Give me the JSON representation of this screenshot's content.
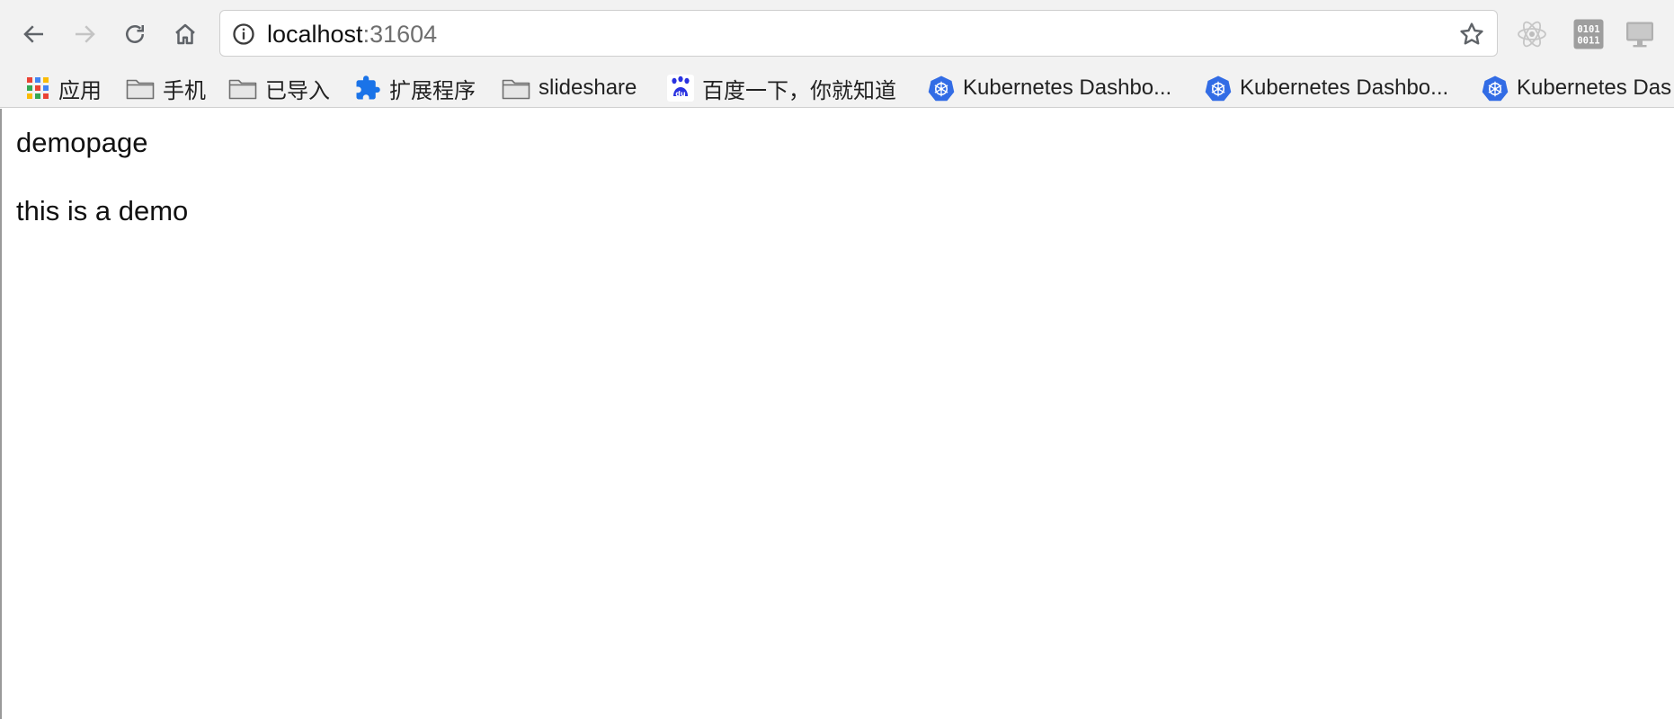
{
  "browser": {
    "url_host": "localhost",
    "url_port": ":31604"
  },
  "icons": {
    "back": "back-arrow-icon",
    "forward": "forward-arrow-icon",
    "reload": "reload-icon",
    "home": "home-icon",
    "site_info": "info-icon",
    "bookmark_star": "star-icon",
    "extensions": [
      "react-devtools-icon",
      "binary-extension-icon",
      "monitor-extension-icon"
    ]
  },
  "bookmarks": [
    {
      "label": "应用",
      "icon": "apps-grid-icon"
    },
    {
      "label": "手机",
      "icon": "folder-icon"
    },
    {
      "label": "已导入",
      "icon": "folder-icon"
    },
    {
      "label": "扩展程序",
      "icon": "puzzle-icon"
    },
    {
      "label": "slideshare",
      "icon": "folder-icon"
    },
    {
      "label": "百度一下，你就知道",
      "icon": "baidu-icon"
    },
    {
      "label": "Kubernetes Dashbo...",
      "icon": "kubernetes-icon"
    },
    {
      "label": "Kubernetes Dashbo...",
      "icon": "kubernetes-icon"
    },
    {
      "label": "Kubernetes Das",
      "icon": "kubernetes-icon"
    }
  ],
  "page": {
    "heading": "demopage",
    "paragraph": "this is a demo"
  },
  "colors": {
    "kubernetes_blue": "#326ce5",
    "puzzle_blue": "#1a73e8",
    "baidu_blue": "#2932e1"
  }
}
